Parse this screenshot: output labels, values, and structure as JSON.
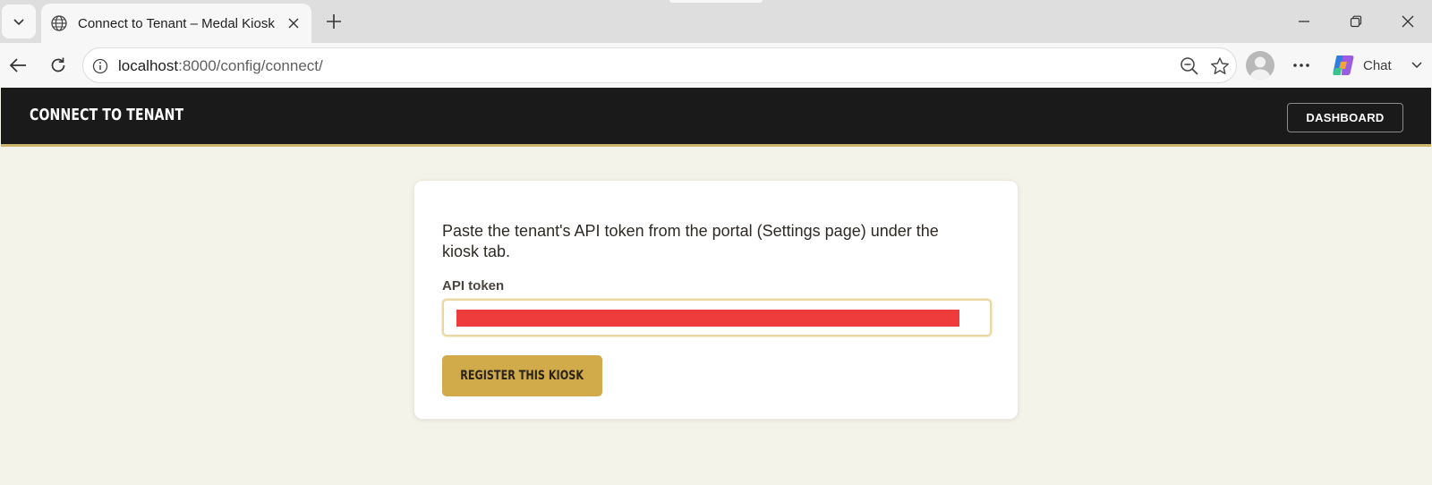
{
  "browser": {
    "tab_title": "Connect to Tenant – Medal Kiosk",
    "url_host": "localhost",
    "url_rest": ":8000/config/connect/",
    "copilot_label": "Chat"
  },
  "header": {
    "title": "CONNECT TO TENANT",
    "dashboard_label": "DASHBOARD"
  },
  "form": {
    "instructions": "Paste the tenant's API token from the portal (Settings page) under the kiosk tab.",
    "token_label": "API token",
    "token_value_redacted": true,
    "submit_label": "REGISTER THIS KIOSK"
  },
  "colors": {
    "header_bg": "#1b1a1a",
    "accent_gold": "#d1ab49",
    "page_bg": "#f4f3ea",
    "redaction": "#ee3b3b"
  },
  "icons": [
    "tab-list-icon",
    "globe-icon",
    "close-icon",
    "plus-icon",
    "minimize-icon",
    "restore-icon",
    "back-icon",
    "reload-icon",
    "info-icon",
    "zoom-out-icon",
    "star-icon",
    "profile-icon",
    "more-icon",
    "copilot-icon",
    "chevron-down-icon"
  ]
}
